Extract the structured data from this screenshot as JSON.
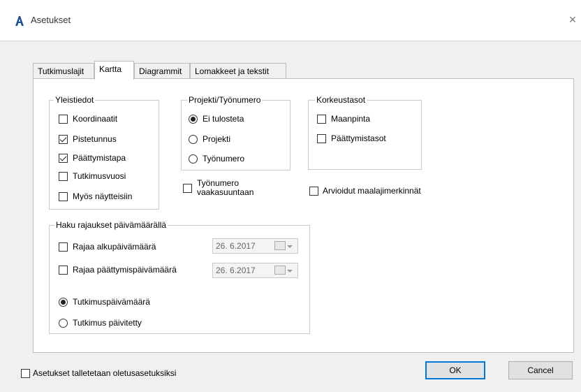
{
  "window": {
    "title": "Asetukset",
    "close_symbol": "×"
  },
  "tabs": [
    {
      "label": "Tutkimuslajit",
      "active": false
    },
    {
      "label": "Kartta",
      "active": true
    },
    {
      "label": "Diagrammit",
      "active": false
    },
    {
      "label": "Lomakkeet ja tekstit",
      "active": false
    }
  ],
  "yleistiedot": {
    "title": "Yleistiedot",
    "items": [
      {
        "label": "Koordinaatit",
        "checked": false
      },
      {
        "label": "Pistetunnus",
        "checked": true
      },
      {
        "label": "Päättymistapa",
        "checked": true
      },
      {
        "label": "Tutkimusvuosi",
        "checked": false
      },
      {
        "label": "Myös näytteisiin",
        "checked": false
      }
    ]
  },
  "projekti": {
    "title": "Projekti/Työnumero",
    "options": [
      {
        "label": "Ei tulosteta",
        "selected": true
      },
      {
        "label": "Projekti",
        "selected": false
      },
      {
        "label": "Työnumero",
        "selected": false
      }
    ]
  },
  "tyonumero_vaaka": {
    "label_line1": "Työnumero",
    "label_line2": "vaakasuuntaan",
    "checked": false
  },
  "korkeustasot": {
    "title": "Korkeustasot",
    "items": [
      {
        "label": "Maanpinta",
        "checked": false
      },
      {
        "label": "Päättymistasot",
        "checked": false
      }
    ]
  },
  "arvioidut": {
    "label": "Arvioidut maalajimerkinnät",
    "checked": false
  },
  "haku": {
    "title": "Haku rajaukset päivämäärällä",
    "alku": {
      "label": "Rajaa alkupäivämäärä",
      "checked": false,
      "date": "26.  6.2017"
    },
    "loppu": {
      "label": "Rajaa päättymispäivämäärä",
      "checked": false,
      "date": "26.  6.2017"
    },
    "options": [
      {
        "label": "Tutkimuspäivämäärä",
        "selected": true
      },
      {
        "label": "Tutkimus päivitetty",
        "selected": false
      }
    ]
  },
  "oletus": {
    "label": "Asetukset talletetaan oletusasetuksiksi",
    "checked": false
  },
  "buttons": {
    "ok": "OK",
    "cancel": "Cancel"
  }
}
